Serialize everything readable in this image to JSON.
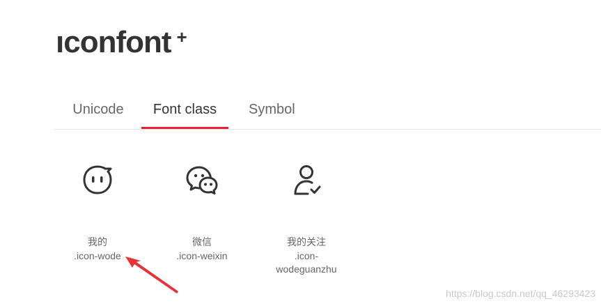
{
  "logo": {
    "text": "ıconfont",
    "plus": "+"
  },
  "tabs": [
    {
      "label": "Unicode",
      "active": false
    },
    {
      "label": "Font class",
      "active": true
    },
    {
      "label": "Symbol",
      "active": false
    }
  ],
  "icons": [
    {
      "name": "我的",
      "code": ".icon-wode",
      "icon": "chat-bubble-face-icon"
    },
    {
      "name": "微信",
      "code": ".icon-weixin",
      "icon": "wechat-icon"
    },
    {
      "name": "我的关注",
      "code": ".icon-wodeguanzhu",
      "code_line1": ".icon-",
      "code_line2": "wodeguanzhu",
      "icon": "user-check-icon"
    }
  ],
  "annotation": {
    "arrow_color": "#e8323a"
  },
  "watermark": "https://blog.csdn.net/qq_46293423",
  "colors": {
    "accent": "#e8222e",
    "text": "#333333",
    "muted": "#666666"
  }
}
